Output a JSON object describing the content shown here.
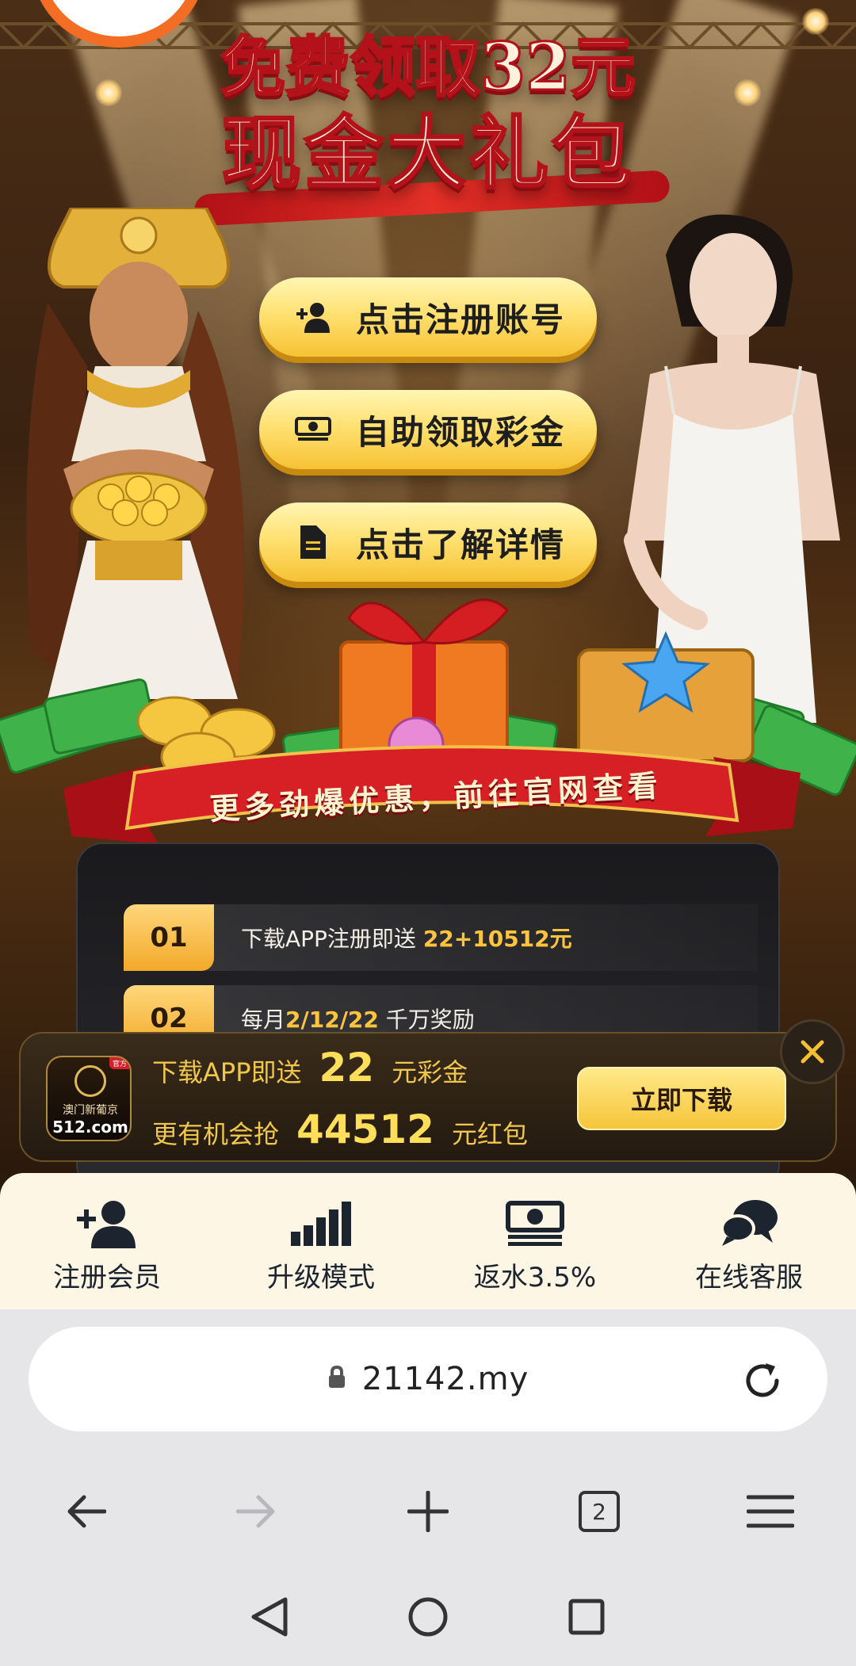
{
  "hero": {
    "headline_line1": "免费领取32元",
    "headline_line2": "现金大礼包"
  },
  "buttons": [
    {
      "label": "点击注册账号",
      "icon": "add-user-icon"
    },
    {
      "label": "自助领取彩金",
      "icon": "cash-icon"
    },
    {
      "label": "点击了解详情",
      "icon": "document-icon"
    }
  ],
  "banner": {
    "text": "更多劲爆优惠，前往官网查看"
  },
  "promo_list": [
    {
      "num": "01",
      "text_before": "下载APP注册即送 ",
      "highlight": "22+10512元",
      "text_after": ""
    },
    {
      "num": "02",
      "text_before": "每月",
      "highlight": "2/12/22",
      "text_after": " 千万奖励"
    }
  ],
  "download": {
    "logo_name": "澳门新葡京",
    "logo_domain": "512.com",
    "logo_tag": "官方",
    "line1_prefix": "下载APP即送",
    "line1_amount": "22",
    "line1_suffix": "元彩金",
    "line2_prefix": "更有机会抢",
    "line2_amount": "44512",
    "line2_suffix": "元红包",
    "button": "立即下载",
    "close_icon": "close-icon"
  },
  "tabbar": [
    {
      "label": "注册会员",
      "icon": "add-user-icon"
    },
    {
      "label": "升级模式",
      "icon": "bar-chart-icon"
    },
    {
      "label": "返水3.5%",
      "icon": "cash-icon"
    },
    {
      "label": "在线客服",
      "icon": "chat-bubbles-icon"
    }
  ],
  "browser": {
    "url": "21142.my",
    "tab_count": "2"
  },
  "colors": {
    "accent_gold": "#f6c234",
    "headline_red": "#b3121a",
    "panel_dark": "#1a1a1d",
    "highlight_yellow": "#ffc43d",
    "tabbar_bg": "#fdf6e4",
    "chrome_bg": "#e6e6e8"
  }
}
